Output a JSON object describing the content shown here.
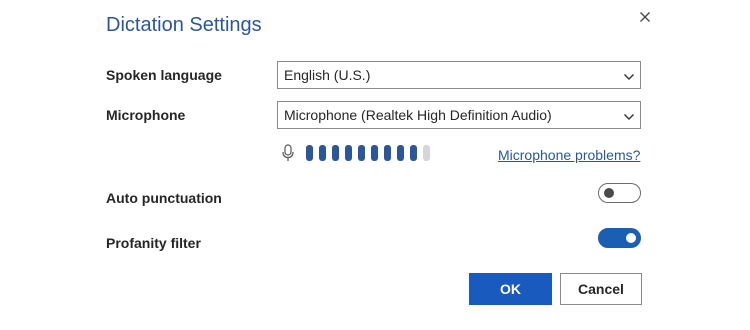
{
  "dialog": {
    "title": "Dictation Settings",
    "close_icon": "close-icon"
  },
  "settings": {
    "spoken_language": {
      "label": "Spoken language",
      "selected": "English (U.S.)"
    },
    "microphone": {
      "label": "Microphone",
      "selected": "Microphone (Realtek High Definition Audio)"
    },
    "mic_level": {
      "icon": "microphone-icon",
      "total_segments": 10,
      "active_segments": 9,
      "active_color": "#2b579a",
      "inactive_color": "#d6d6d6"
    },
    "microphone_problems_link": "Microphone problems?",
    "auto_punctuation": {
      "label": "Auto punctuation",
      "enabled": false
    },
    "profanity_filter": {
      "label": "Profanity filter",
      "enabled": true
    }
  },
  "buttons": {
    "ok_label": "OK",
    "cancel_label": "Cancel"
  },
  "colors": {
    "accent": "#185abd",
    "title": "#2b579a"
  }
}
